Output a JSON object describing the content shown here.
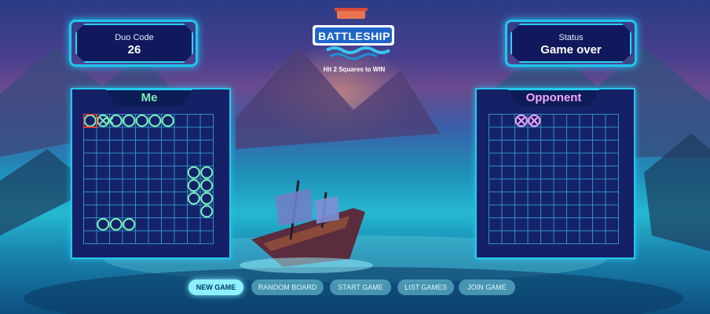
{
  "header": {
    "logo_text": "BATTLESHIP",
    "subtitle": "Hit 2 Squares to WIN"
  },
  "duo_code": {
    "label": "Duo Code",
    "value": "26"
  },
  "status": {
    "label": "Status",
    "value": "Game over"
  },
  "me_board": {
    "title": "Me",
    "ships": [
      [
        0,
        0
      ],
      [
        0,
        2
      ],
      [
        0,
        3
      ],
      [
        0,
        4
      ],
      [
        0,
        5
      ],
      [
        0,
        6
      ],
      [
        4,
        8
      ],
      [
        4,
        9
      ],
      [
        5,
        8
      ],
      [
        5,
        9
      ],
      [
        6,
        8
      ],
      [
        6,
        9
      ],
      [
        7,
        9
      ],
      [
        8,
        1
      ],
      [
        8,
        2
      ],
      [
        8,
        3
      ]
    ],
    "hits": [
      [
        0,
        1
      ]
    ],
    "misses": [
      [
        0,
        2
      ]
    ],
    "last_move": [
      0,
      0
    ]
  },
  "opponent_board": {
    "title": "Opponent",
    "hits": [
      [
        0,
        2
      ],
      [
        0,
        3
      ]
    ]
  },
  "buttons": [
    {
      "label": "NEW GAME",
      "state": "active"
    },
    {
      "label": "RANDOM BOARD",
      "state": "disabled"
    },
    {
      "label": "START GAME",
      "state": "disabled"
    },
    {
      "label": "LIST GAMES",
      "state": "disabled"
    },
    {
      "label": "JOIN GAME",
      "state": "disabled"
    }
  ],
  "colors": {
    "accent": "#26c8ef",
    "ship": "#7df0b8",
    "opponent_hit": "#f3a6ff",
    "highlight": "#e23b3b",
    "grid_line": "#2e8fc7"
  }
}
